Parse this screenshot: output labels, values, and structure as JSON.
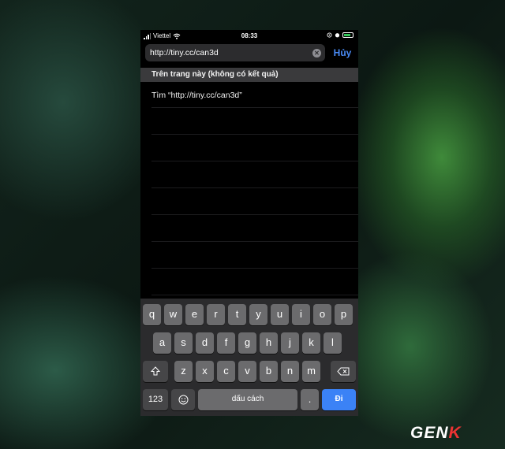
{
  "status_bar": {
    "carrier": "Viettel",
    "time": "08:33"
  },
  "url_bar": {
    "value": "http://tiny.cc/can3d",
    "cancel_label": "Hủy"
  },
  "results": {
    "section_header": "Trên trang này (không có kết quả)",
    "find_label": "Tìm “http://tiny.cc/can3d”"
  },
  "keyboard": {
    "row1": [
      "q",
      "w",
      "e",
      "r",
      "t",
      "y",
      "u",
      "i",
      "o",
      "p"
    ],
    "row2": [
      "a",
      "s",
      "d",
      "f",
      "g",
      "h",
      "j",
      "k",
      "l"
    ],
    "row3": [
      "z",
      "x",
      "c",
      "v",
      "b",
      "n",
      "m"
    ],
    "numbers_label": "123",
    "space_label": "dấu cách",
    "dot_label": ".",
    "go_label": "Đi"
  },
  "watermark": {
    "text_a": "GEN",
    "text_b": "K"
  }
}
